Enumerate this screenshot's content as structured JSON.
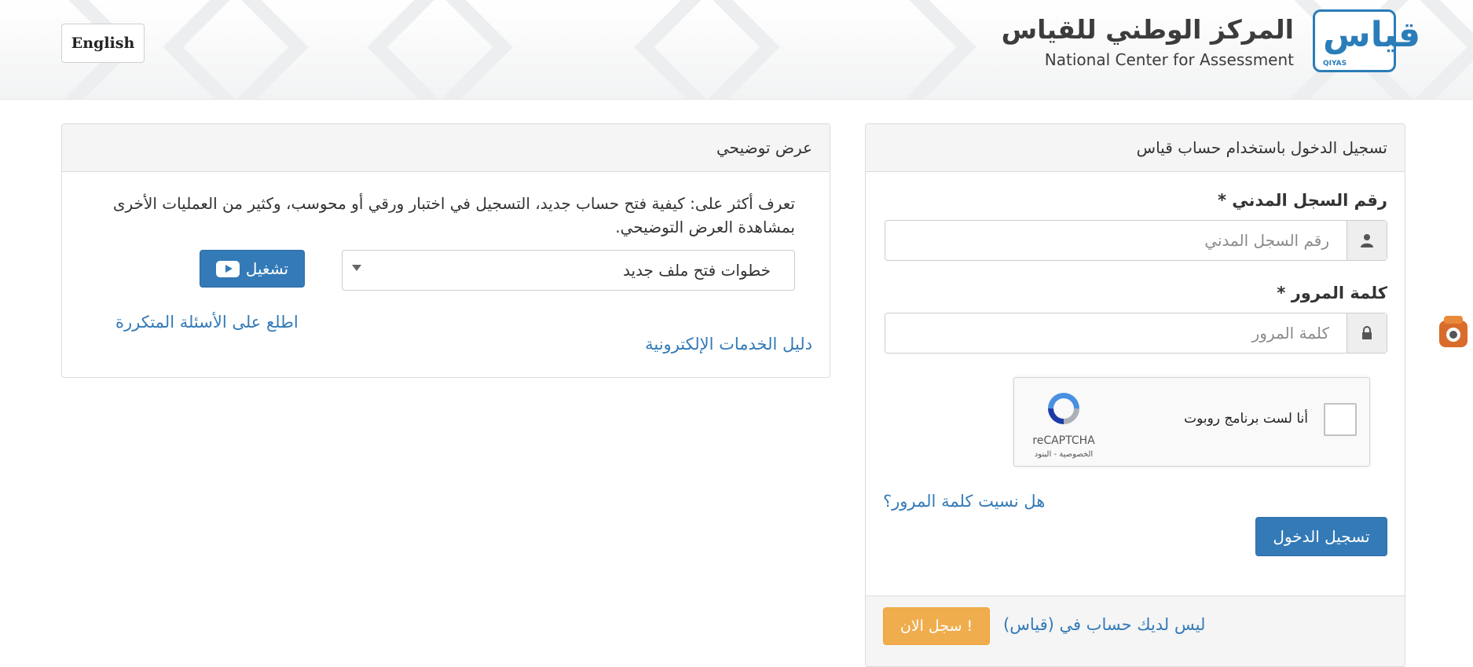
{
  "header": {
    "language_button": "English",
    "org_name_ar": "المركز الوطني للقياس",
    "org_name_en": "National Center for Assessment",
    "logo_caption": "QIYAS",
    "logo_glyph": "قياس",
    "brand_color": "#2a7db8"
  },
  "login": {
    "title": "تسجيل الدخول باستخدام حساب قياس",
    "national_id_label": "رقم السجل المدني *",
    "national_id_placeholder": "رقم السجل المدني",
    "national_id_icon": "user-icon",
    "password_label": "كلمة المرور *",
    "password_placeholder": "كلمة المرور",
    "password_icon": "lock-icon",
    "recaptcha": {
      "label": "أنا لست برنامج روبوت",
      "brand": "reCAPTCHA",
      "links": "الخصوصية - البنود"
    },
    "forgot_password": "هل نسيت كلمة المرور؟",
    "submit_button": "تسجيل الدخول",
    "no_account_text": "ليس لديك حساب في (قياس)",
    "signup_button": "سجل الان !"
  },
  "demo": {
    "title": "عرض توضيحي",
    "description": "تعرف أكثر على: كيفية فتح حساب جديد، التسجيل في اختبار ورقي أو محوسب، وكثير من العمليات الأخرى بمشاهدة العرض التوضيحي.",
    "selected_option": "خطوات فتح ملف جديد",
    "play_button": "تشغيل",
    "faq_link": "اطلع على الأسئلة المتكررة",
    "guide_link": "دليل الخدمات الإلكترونية"
  },
  "colors": {
    "primary": "#337ab7",
    "warning": "#f0ad4e"
  }
}
